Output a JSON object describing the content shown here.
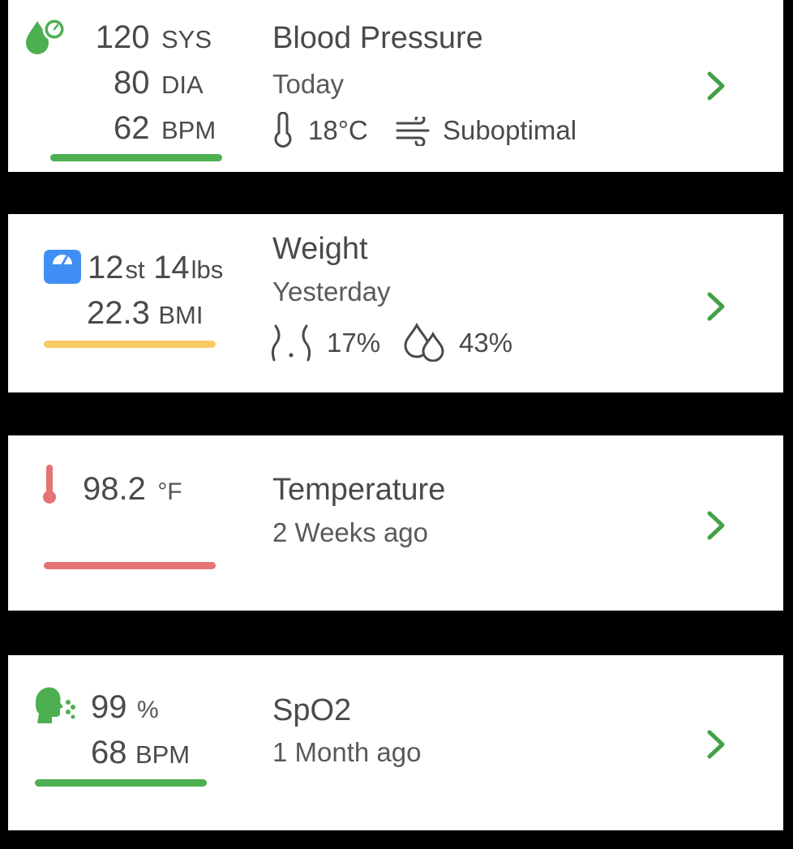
{
  "colors": {
    "green": "#4caf50",
    "yellow": "#f9cb62",
    "red": "#e57373",
    "blue": "#3f8ff5",
    "chevron": "#43a047"
  },
  "cards": {
    "blood_pressure": {
      "icon": "blood-pressure-drop-gauge-icon",
      "sys_value": "120",
      "sys_unit": "SYS",
      "dia_value": "80",
      "dia_unit": "DIA",
      "pulse_value": "62",
      "pulse_unit": "BPM",
      "title": "Blood Pressure",
      "when": "Today",
      "temperature": "18°C",
      "air_quality": "Suboptimal",
      "status_color": "green"
    },
    "weight": {
      "icon": "weighing-scale-icon",
      "stones": "12",
      "stones_unit": "st",
      "pounds": "14",
      "pounds_unit": "lbs",
      "bmi_value": "22.3",
      "bmi_unit": "BMI",
      "title": "Weight",
      "when": "Yesterday",
      "body_fat": "17%",
      "water": "43%",
      "status_color": "yellow"
    },
    "temperature": {
      "icon": "thermometer-icon",
      "value": "98.2",
      "unit": "°F",
      "title": "Temperature",
      "when": "2 Weeks ago",
      "status_color": "red"
    },
    "spo2": {
      "icon": "breathing-head-icon",
      "oxygen_value": "99",
      "oxygen_unit": "%",
      "pulse_value": "68",
      "pulse_unit": "BPM",
      "title": "SpO2",
      "when": "1 Month ago",
      "status_color": "green"
    }
  }
}
